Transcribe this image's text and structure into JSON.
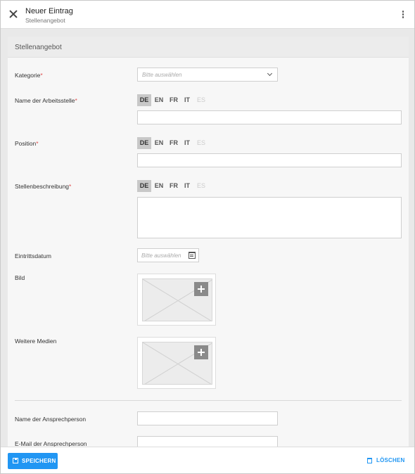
{
  "header": {
    "title": "Neuer Eintrag",
    "subtitle": "Stellenangebot"
  },
  "panel": {
    "title": "Stellenangebot"
  },
  "required_marker": "*",
  "languages": [
    "DE",
    "EN",
    "FR",
    "IT",
    "ES"
  ],
  "fields": {
    "kategorie": {
      "label": "Kategorie",
      "placeholder": "Bitte auswählen"
    },
    "arbeitsstelle": {
      "label": "Name der Arbeitsstelle",
      "value": ""
    },
    "position": {
      "label": "Position",
      "value": ""
    },
    "beschreibung": {
      "label": "Stellenbeschreibung",
      "value": ""
    },
    "eintrittsdatum": {
      "label": "Eintrittsdatum",
      "placeholder": "Bitte auswählen"
    },
    "bild": {
      "label": "Bild"
    },
    "medien": {
      "label": "Weitere Medien"
    },
    "ansprechperson": {
      "label": "Name der Ansprechperson",
      "value": ""
    },
    "email": {
      "label": "E-Mail der Ansprechperson",
      "value": ""
    }
  },
  "footer": {
    "save_label": "SPEICHERN",
    "delete_label": "LÖSCHEN"
  },
  "colors": {
    "accent": "#2196f3",
    "required": "#e05050"
  },
  "icons": {
    "close": "close-icon",
    "more": "more-vertical-icon",
    "chevron": "chevron-down-icon",
    "calendar": "calendar-icon",
    "add": "plus-icon",
    "save": "save-icon",
    "delete": "trash-icon"
  }
}
